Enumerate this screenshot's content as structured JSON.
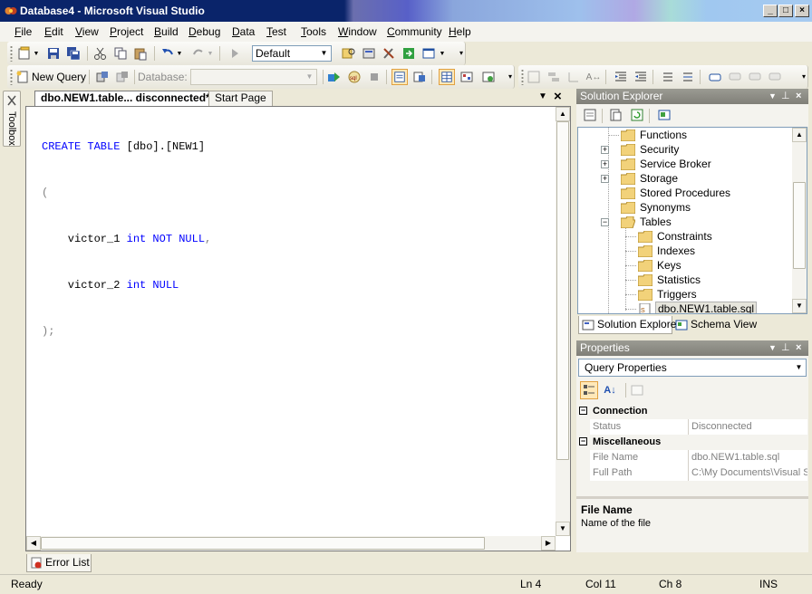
{
  "window": {
    "title": "Database4 - Microsoft Visual Studio"
  },
  "menu": [
    "File",
    "Edit",
    "View",
    "Project",
    "Build",
    "Debug",
    "Data",
    "Test",
    "Tools",
    "Window",
    "Community",
    "Help"
  ],
  "toolbar1": {
    "config_value": "Default"
  },
  "toolbar2": {
    "new_query_label": "New Query",
    "database_label": "Database:",
    "database_value": ""
  },
  "toolbox": {
    "label": "Toolbox"
  },
  "doc_tabs": [
    {
      "label": "dbo.NEW1.table... disconnected*"
    },
    {
      "label": "Start Page"
    }
  ],
  "editor": {
    "lines": [
      {
        "a": "CREATE TABLE",
        "b": " [dbo].[NEW1]"
      },
      {
        "a": "("
      },
      {
        "a": "    victor_1 ",
        "b": "int NOT NULL",
        "c": ","
      },
      {
        "a": "    victor_2 ",
        "b": "int NULL"
      },
      {
        "a": ");"
      }
    ]
  },
  "solution_explorer": {
    "title": "Solution Explorer",
    "tree": [
      {
        "label": "Functions"
      },
      {
        "label": "Security"
      },
      {
        "label": "Service Broker"
      },
      {
        "label": "Storage"
      },
      {
        "label": "Stored Procedures"
      },
      {
        "label": "Synonyms"
      },
      {
        "label": "Tables"
      },
      {
        "label": "Constraints"
      },
      {
        "label": "Indexes"
      },
      {
        "label": "Keys"
      },
      {
        "label": "Statistics"
      },
      {
        "label": "Triggers"
      },
      {
        "label": "dbo.NEW1.table.sql"
      }
    ],
    "tabs": [
      "Solution Explorer",
      "Schema View"
    ]
  },
  "properties": {
    "title": "Properties",
    "object": "Query Properties",
    "categories": [
      {
        "name": "Connection",
        "rows": [
          {
            "name": "Status",
            "value": "Disconnected"
          }
        ]
      },
      {
        "name": "Miscellaneous",
        "rows": [
          {
            "name": "File Name",
            "value": "dbo.NEW1.table.sql"
          },
          {
            "name": "Full Path",
            "value": "C:\\My Documents\\Visual St"
          }
        ]
      }
    ],
    "desc_title": "File Name",
    "desc_text": "Name of the file"
  },
  "bottom_tabs": [
    "Error List"
  ],
  "status": {
    "message": "Ready",
    "ln": "Ln 4",
    "col": "Col 11",
    "ch": "Ch 8",
    "mode": "INS"
  },
  "colors": {
    "keyword": "#0000ff",
    "title_bar": "#0a246a",
    "panel_title": "#8c8b84"
  }
}
